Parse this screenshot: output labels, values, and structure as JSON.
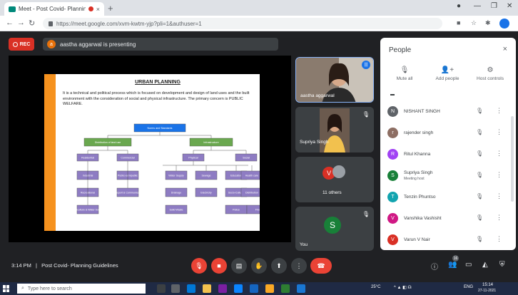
{
  "browser": {
    "tab_title": "Meet - Post Covid- Planning",
    "tab_close": "×",
    "new_tab": "+",
    "url": "https://meet.google.com/xvm-kwtm-yjp?pli=1&authuser=1",
    "win_min": "—",
    "win_max": "❐",
    "win_close": "✕"
  },
  "meet": {
    "rec_label": "REC",
    "presenting_initial": "a",
    "presenting_text": "aastha aggarwal is presenting"
  },
  "slide": {
    "title": "URBAN PLANNING",
    "body": "It is a technical and political process which is focused on development and design of land uses and the built environment with the consideration of social and physical infrastructure. The primary concern is PUBLIC WELFARE.",
    "diagram": {
      "root": "Norms and Standards",
      "level1": [
        "Distribution of land use",
        "Infrastructure"
      ],
      "level2": [
        "Residential",
        "Commercial",
        "Physical",
        "Social"
      ],
      "level3": [
        "Industrial",
        "Public-semipublic",
        "Water Supply",
        "Sewage",
        "Education",
        "Health care"
      ],
      "level4": [
        "Recreational",
        "Transport & Communication",
        "Drainage",
        "Electricity",
        "Socio-Cultural",
        "Distribution"
      ],
      "level5": [
        "Agriculture & Water bodies",
        "Solid Waste",
        "Police",
        "Fire"
      ]
    }
  },
  "tiles": [
    {
      "name": "aastha aggarwal"
    },
    {
      "name": "Supriya Singh"
    },
    {
      "initial": "V",
      "name": "11 others"
    },
    {
      "initial": "S",
      "name": "You"
    }
  ],
  "people": {
    "title": "People",
    "close": "×",
    "actions": [
      {
        "icon": "🎙",
        "label": "Mute all"
      },
      {
        "icon": "👤+",
        "label": "Add people"
      },
      {
        "icon": "⚙",
        "label": "Host controls"
      }
    ],
    "list": [
      {
        "initial": "N",
        "name": "NISHANT SINGH",
        "sub": "",
        "color": "#5f6368"
      },
      {
        "initial": "r",
        "name": "rajender singh",
        "sub": "",
        "color": "#8d6e63"
      },
      {
        "initial": "R",
        "name": "Ritul Khanna",
        "sub": "",
        "color": "#a142f4"
      },
      {
        "initial": "S",
        "name": "Supriya Singh",
        "sub": "Meeting host",
        "color": "#188038"
      },
      {
        "initial": "T",
        "name": "Tenzin Phuntso",
        "sub": "",
        "color": "#12a4af"
      },
      {
        "initial": "V",
        "name": "Vanshika Vashisht",
        "sub": "",
        "color": "#d01884"
      },
      {
        "initial": "V",
        "name": "Varun V Nair",
        "sub": "",
        "color": "#d93025"
      }
    ]
  },
  "bottom": {
    "time": "3:14 PM",
    "separator": "|",
    "meeting_title": "Post Covid- Planning Guidelines",
    "participants_badge": "16"
  },
  "taskbar": {
    "search_placeholder": "Type here to search",
    "weather": "25°C",
    "lang": "ENG",
    "time": "15:14",
    "date": "27-11-2021"
  },
  "colors": {
    "meet_bg": "#202124",
    "danger": "#ea4335",
    "accent": "#1a73e8",
    "slide_accent": "#f6921e",
    "box_fill": "#8e7cc3",
    "green_box": "#6aa84f"
  }
}
